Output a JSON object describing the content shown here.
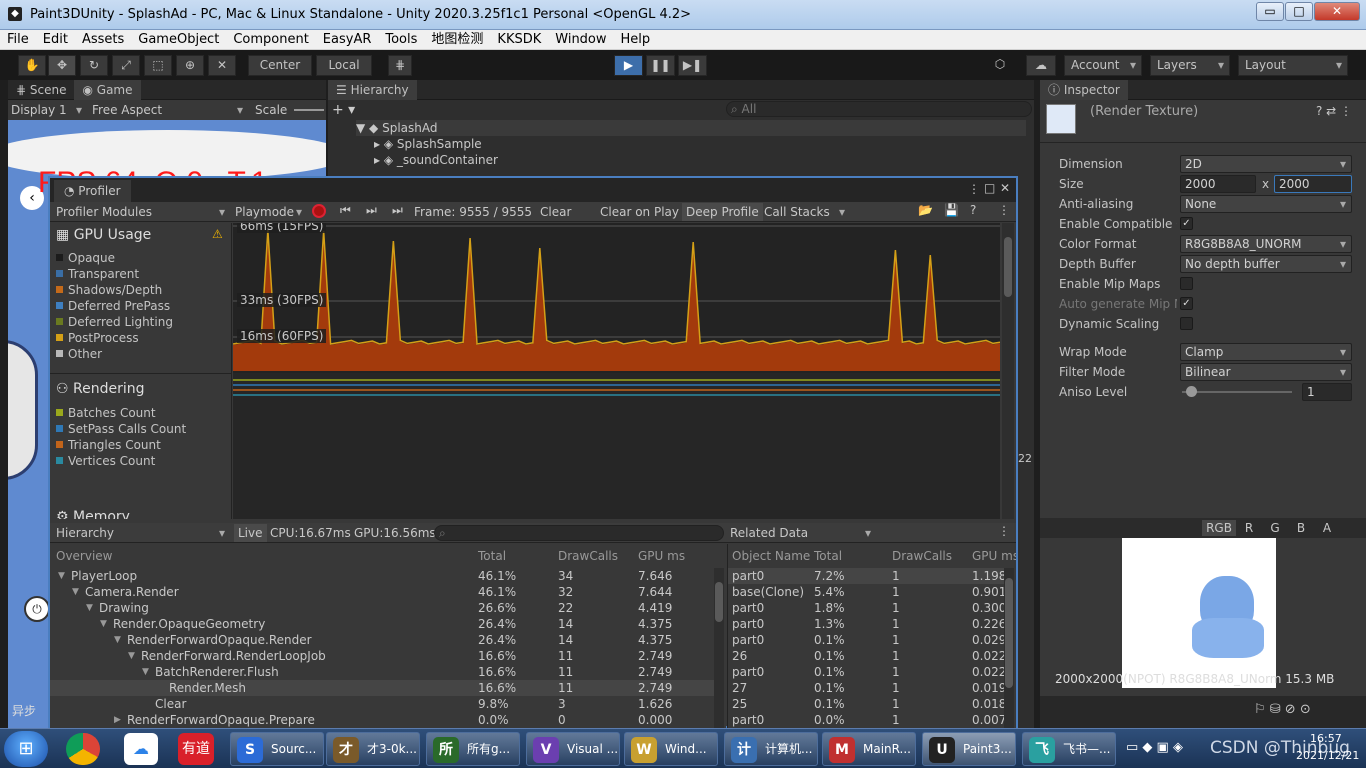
{
  "window": {
    "title": "Paint3DUnity - SplashAd - PC, Mac & Linux Standalone - Unity 2020.3.25f1c1 Personal <OpenGL 4.2>",
    "min": "▭",
    "max": "□",
    "close": "✕"
  },
  "menu": [
    "File",
    "Edit",
    "Assets",
    "GameObject",
    "Component",
    "EasyAR",
    "Tools",
    "地图检测",
    "KKSDK",
    "Window",
    "Help"
  ],
  "toolbar": {
    "center": "Center",
    "local": "Local",
    "account": "Account",
    "layers": "Layers",
    "layout": "Layout"
  },
  "scene": {
    "tab_scene": "Scene",
    "tab_game": "Game",
    "display": "Display 1",
    "aspect": "Free Aspect",
    "scale": "Scale",
    "fps_overlay": "FPS:64 ,Q:0 , T:1 ,"
  },
  "hierarchy": {
    "tab": "Hierarchy",
    "search_placeholder": "All",
    "root": "SplashAd",
    "items": [
      "SplashSample",
      "_soundContainer"
    ]
  },
  "inspector": {
    "tab": "Inspector",
    "object": "(Render Texture)",
    "fields": [
      {
        "label": "Dimension",
        "value": "2D"
      },
      {
        "label": "Size",
        "value": "2000",
        "value2": "2000",
        "sep": "x"
      },
      {
        "label": "Anti-aliasing",
        "value": "None"
      },
      {
        "label": "Enable Compatible C",
        "check": "✓"
      },
      {
        "label": "Color Format",
        "value": "R8G8B8A8_UNORM"
      },
      {
        "label": "Depth Buffer",
        "value": "No depth buffer"
      },
      {
        "label": "Enable Mip Maps",
        "check": ""
      },
      {
        "label": "Auto generate Mip M",
        "check": "✓"
      },
      {
        "label": "Dynamic Scaling",
        "check": ""
      },
      {
        "label": "Wrap Mode",
        "value": "Clamp"
      },
      {
        "label": "Filter Mode",
        "value": "Bilinear"
      },
      {
        "label": "Aniso Level",
        "value": "1"
      }
    ],
    "preview_channels": [
      "RGB",
      "R",
      "G",
      "B",
      "A"
    ],
    "preview_info": "2000x2000(NPOT)  R8G8B8A8_UNorm  15.3 MB"
  },
  "profiler": {
    "title": "Profiler",
    "modules_label": "Profiler Modules",
    "playmode": "Playmode",
    "frame": "Frame: 9555 / 9555",
    "clear": "Clear",
    "clear_on_play": "Clear on Play",
    "deep_profile": "Deep Profile",
    "call_stacks": "Call Stacks",
    "gpu_module": "GPU Usage",
    "gpu_legend": [
      {
        "name": "Opaque",
        "color": "#1c1c1c"
      },
      {
        "name": "Transparent",
        "color": "#3a6ea5"
      },
      {
        "name": "Shadows/Depth",
        "color": "#c46a1a"
      },
      {
        "name": "Deferred PrePass",
        "color": "#3e7fc0"
      },
      {
        "name": "Deferred Lighting",
        "color": "#6a7a20"
      },
      {
        "name": "PostProcess",
        "color": "#d4a017"
      },
      {
        "name": "Other",
        "color": "#b8b8b8"
      }
    ],
    "rendering_module": "Rendering",
    "rendering_legend": [
      {
        "name": "Batches Count",
        "color": "#9aa81c"
      },
      {
        "name": "SetPass Calls Count",
        "color": "#2f78b5"
      },
      {
        "name": "Triangles Count",
        "color": "#c2641a"
      },
      {
        "name": "Vertices Count",
        "color": "#2a8aa0"
      }
    ],
    "memory_module": "Memory",
    "chart_labels": [
      "66ms (15FPS)",
      "33ms (30FPS)",
      "16ms (60FPS)"
    ],
    "spike_frames": [
      5,
      13,
      23,
      34,
      44,
      66,
      95,
      100
    ],
    "hier_dropdown": "Hierarchy",
    "live": "Live",
    "cpu": "CPU:16.67ms",
    "gpu": "GPU:16.56ms",
    "columns": [
      "Overview",
      "Total",
      "DrawCalls",
      "GPU ms"
    ],
    "rows": [
      {
        "name": "PlayerLoop",
        "total": "46.1%",
        "dc": "34",
        "gpu": "7.646",
        "indent": 0,
        "arrow": "▼"
      },
      {
        "name": "Camera.Render",
        "total": "46.1%",
        "dc": "32",
        "gpu": "7.644",
        "indent": 1,
        "arrow": "▼"
      },
      {
        "name": "Drawing",
        "total": "26.6%",
        "dc": "22",
        "gpu": "4.419",
        "indent": 2,
        "arrow": "▼"
      },
      {
        "name": "Render.OpaqueGeometry",
        "total": "26.4%",
        "dc": "14",
        "gpu": "4.375",
        "indent": 3,
        "arrow": "▼"
      },
      {
        "name": "RenderForwardOpaque.Render",
        "total": "26.4%",
        "dc": "14",
        "gpu": "4.375",
        "indent": 4,
        "arrow": "▼"
      },
      {
        "name": "RenderForward.RenderLoopJob",
        "total": "16.6%",
        "dc": "11",
        "gpu": "2.749",
        "indent": 5,
        "arrow": "▼"
      },
      {
        "name": "BatchRenderer.Flush",
        "total": "16.6%",
        "dc": "11",
        "gpu": "2.749",
        "indent": 6,
        "arrow": "▼"
      },
      {
        "name": "Render.Mesh",
        "total": "16.6%",
        "dc": "11",
        "gpu": "2.749",
        "indent": 7,
        "arrow": ""
      },
      {
        "name": "Clear",
        "total": "9.8%",
        "dc": "3",
        "gpu": "1.626",
        "indent": 6,
        "arrow": ""
      },
      {
        "name": "RenderForwardOpaque.Prepare",
        "total": "0.0%",
        "dc": "0",
        "gpu": "0.000",
        "indent": 4,
        "arrow": "▶"
      }
    ],
    "related_label": "Related Data",
    "related_columns": [
      "Object Name",
      "Total",
      "DrawCalls",
      "GPU ms"
    ],
    "related_rows": [
      {
        "name": "part0",
        "total": "7.2%",
        "dc": "1",
        "gpu": "1.198"
      },
      {
        "name": "base(Clone)",
        "total": "5.4%",
        "dc": "1",
        "gpu": "0.901"
      },
      {
        "name": "part0",
        "total": "1.8%",
        "dc": "1",
        "gpu": "0.300"
      },
      {
        "name": "part0",
        "total": "1.3%",
        "dc": "1",
        "gpu": "0.226"
      },
      {
        "name": "part0",
        "total": "0.1%",
        "dc": "1",
        "gpu": "0.029"
      },
      {
        "name": "26",
        "total": "0.1%",
        "dc": "1",
        "gpu": "0.022"
      },
      {
        "name": "part0",
        "total": "0.1%",
        "dc": "1",
        "gpu": "0.022"
      },
      {
        "name": "27",
        "total": "0.1%",
        "dc": "1",
        "gpu": "0.019"
      },
      {
        "name": "25",
        "total": "0.1%",
        "dc": "1",
        "gpu": "0.018"
      },
      {
        "name": "part0",
        "total": "0.0%",
        "dc": "1",
        "gpu": "0.007"
      }
    ]
  },
  "status": {
    "left_text": "异步",
    "count": "22"
  },
  "taskbar": {
    "tasks": [
      {
        "label": "Sourc...",
        "icon": "S",
        "color": "#2c6bd6"
      },
      {
        "label": "才3-0k...",
        "icon": "才",
        "color": "#7a5a2a"
      },
      {
        "label": "所有g...",
        "icon": "所",
        "color": "#2a6a2a"
      },
      {
        "label": "Visual ...",
        "icon": "V",
        "color": "#6b3fb0"
      },
      {
        "label": "Wind...",
        "icon": "W",
        "color": "#c8a030"
      },
      {
        "label": "计算机...",
        "icon": "计",
        "color": "#3a6fb0"
      },
      {
        "label": "MainR...",
        "icon": "M",
        "color": "#c03030"
      },
      {
        "label": "Paint3...",
        "icon": "U",
        "color": "#222222"
      },
      {
        "label": "飞书—...",
        "icon": "飞",
        "color": "#2aa0a0"
      }
    ],
    "clock_time": "16:57",
    "clock_date": "2021/12/21",
    "watermark": "CSDN @Thinbug"
  }
}
